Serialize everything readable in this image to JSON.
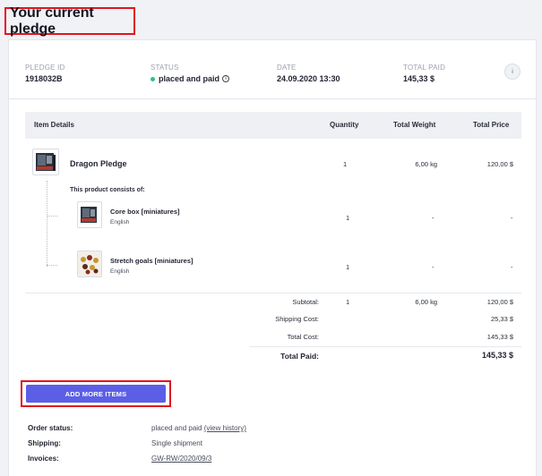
{
  "page": {
    "title": "Your current pledge"
  },
  "summary": {
    "pledge_id_label": "PLEDGE ID",
    "pledge_id": "1918032B",
    "status_label": "STATUS",
    "status": "placed and paid",
    "date_label": "DATE",
    "date": "24.09.2020 13:30",
    "total_paid_label": "TOTAL PAID",
    "total_paid": "145,33 $"
  },
  "table": {
    "headers": {
      "item_details": "Item Details",
      "quantity": "Quantity",
      "total_weight": "Total Weight",
      "total_price": "Total Price"
    },
    "product": {
      "name": "Dragon Pledge",
      "quantity": "1",
      "weight": "6,00 kg",
      "price": "120,00 $"
    },
    "consists_label": "This product consists of:",
    "sub_items": [
      {
        "name": "Core box [miniatures]",
        "language": "English",
        "quantity": "1",
        "weight": "-",
        "price": "-"
      },
      {
        "name": "Stretch goals [miniatures]",
        "language": "English",
        "quantity": "1",
        "weight": "-",
        "price": "-"
      }
    ],
    "totals": {
      "subtotal_label": "Subtotal:",
      "subtotal_qty": "1",
      "subtotal_weight": "6,00 kg",
      "subtotal_price": "120,00 $",
      "shipping_label": "Shipping Cost:",
      "shipping_price": "25,33 $",
      "total_cost_label": "Total Cost:",
      "total_cost_price": "145,33 $",
      "total_paid_label": "Total Paid:",
      "total_paid_price": "145,33 $"
    }
  },
  "actions": {
    "add_more_items": "ADD MORE ITEMS"
  },
  "order_meta": {
    "order_status_label": "Order status:",
    "order_status_value": "placed and paid",
    "view_history": "(view history)",
    "shipping_label": "Shipping:",
    "shipping_value": "Single shipment",
    "invoices_label": "Invoices:",
    "invoice_link": "GW-RW/2020/09/3"
  },
  "colors": {
    "accent": "#5b5fe6",
    "highlight": "#e0151f",
    "status_dot": "#2ec27e"
  }
}
